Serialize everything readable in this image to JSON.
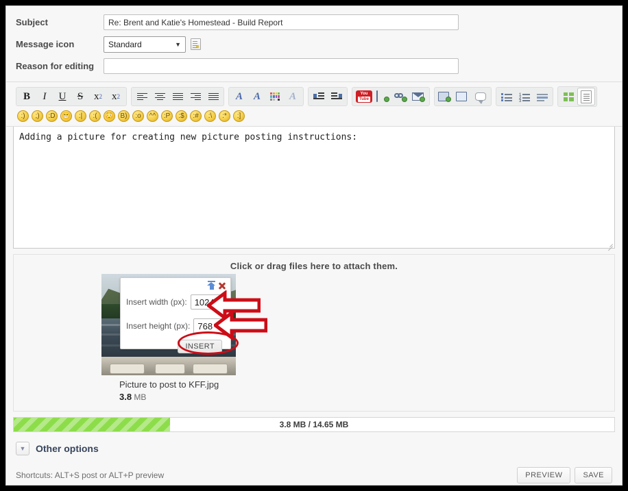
{
  "form": {
    "subject": {
      "label": "Subject",
      "value": "Re: Brent and Katie's Homestead - Build Report",
      "placeholder": ""
    },
    "message_icon": {
      "label": "Message icon",
      "value": "Standard",
      "options": [
        "Standard"
      ]
    },
    "reason": {
      "label": "Reason for editing",
      "value": "",
      "placeholder": ""
    }
  },
  "toolbar": {
    "groups": [
      {
        "name": "text-style",
        "buttons": [
          {
            "name": "bold",
            "label": "B"
          },
          {
            "name": "italic",
            "label": "I"
          },
          {
            "name": "underline",
            "label": "U"
          },
          {
            "name": "strikethrough",
            "label": "S"
          },
          {
            "name": "superscript",
            "label": "x"
          },
          {
            "name": "subscript",
            "label": "x"
          }
        ]
      },
      {
        "name": "alignment",
        "buttons": [
          {
            "name": "align-left",
            "label": ""
          },
          {
            "name": "align-center",
            "label": ""
          },
          {
            "name": "align-justify",
            "label": ""
          },
          {
            "name": "align-right",
            "label": ""
          },
          {
            "name": "align-block",
            "label": ""
          }
        ]
      },
      {
        "name": "font",
        "buttons": [
          {
            "name": "font-face",
            "label": "A"
          },
          {
            "name": "font-size",
            "label": "A"
          },
          {
            "name": "font-color",
            "label": ""
          },
          {
            "name": "remove-format",
            "label": "A"
          }
        ]
      },
      {
        "name": "indent",
        "buttons": [
          {
            "name": "float-left",
            "label": ""
          },
          {
            "name": "float-right",
            "label": ""
          }
        ]
      },
      {
        "name": "media",
        "buttons": [
          {
            "name": "youtube",
            "label": "You Tube"
          },
          {
            "name": "insert-image",
            "label": ""
          },
          {
            "name": "insert-link",
            "label": ""
          },
          {
            "name": "insert-email",
            "label": ""
          }
        ]
      },
      {
        "name": "insert",
        "buttons": [
          {
            "name": "insert-table",
            "label": ""
          },
          {
            "name": "insert-code",
            "label": ""
          },
          {
            "name": "insert-quote",
            "label": ""
          }
        ]
      },
      {
        "name": "lists",
        "buttons": [
          {
            "name": "bullet-list",
            "label": ""
          },
          {
            "name": "numbered-list",
            "label": ""
          },
          {
            "name": "horizontal-rule",
            "label": ""
          }
        ]
      },
      {
        "name": "view",
        "buttons": [
          {
            "name": "maximize",
            "label": ""
          },
          {
            "name": "source-view",
            "label": ""
          }
        ]
      }
    ],
    "emoji": [
      "☹",
      "☺",
      "☺",
      "☺",
      "☹",
      "☹",
      "☹",
      "■",
      "☺",
      "☺",
      "☺",
      "☺",
      "☰",
      "☹",
      "☺",
      "☹"
    ]
  },
  "editor": {
    "content": "Adding a picture for creating new picture posting instructions:"
  },
  "attachments": {
    "hint": "Click or drag files here to attach them.",
    "file": {
      "name": "Picture to post to KFF.jpg",
      "size_value": "3.8",
      "size_unit": "MB"
    }
  },
  "insert_dialog": {
    "upload_icon": "upload-icon",
    "close_icon": "close-icon",
    "width_label": "Insert width (px):",
    "width_value": "1024",
    "height_label": "Insert height (px):",
    "height_value": "768",
    "insert_button": "INSERT"
  },
  "progress": {
    "text": "3.8 MB / 14.65 MB",
    "used": "3.8 MB",
    "total": "14.65 MB",
    "percent": 26,
    "fill_color": "#8ddd4b"
  },
  "other_options": {
    "label": "Other options"
  },
  "footer": {
    "shortcuts": "Shortcuts: ALT+S post or ALT+P preview",
    "preview_button": "PREVIEW",
    "save_button": "SAVE"
  },
  "annotations": {
    "accent_color": "#cc0d17",
    "arrow_width_target": "insert-width-input",
    "arrow_height_target": "insert-height-input",
    "ellipse_target": "insert-button"
  }
}
